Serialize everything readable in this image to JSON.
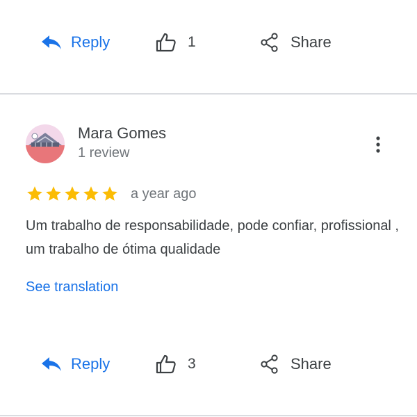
{
  "top_actions": {
    "reply_label": "Reply",
    "like_count": "1",
    "share_label": "Share"
  },
  "review": {
    "author_name": "Mara Gomes",
    "author_meta": "1 review",
    "rating": 5,
    "rating_max": 5,
    "date": "a year ago",
    "text": "Um trabalho de responsabilidade, pode confiar, profissional , um trabalho de ótima qualidade",
    "see_translation_label": "See translation",
    "actions": {
      "reply_label": "Reply",
      "like_count": "3",
      "share_label": "Share"
    }
  },
  "icons": {
    "reply": "reply-icon",
    "like": "thumb-up-icon",
    "share": "share-icon",
    "more": "more-vert-icon",
    "star": "star-icon"
  },
  "colors": {
    "link_blue": "#1a73e8",
    "text_dark": "#3c4043",
    "text_muted": "#70757a",
    "star_gold": "#fbbc04",
    "divider": "#dadce0"
  }
}
